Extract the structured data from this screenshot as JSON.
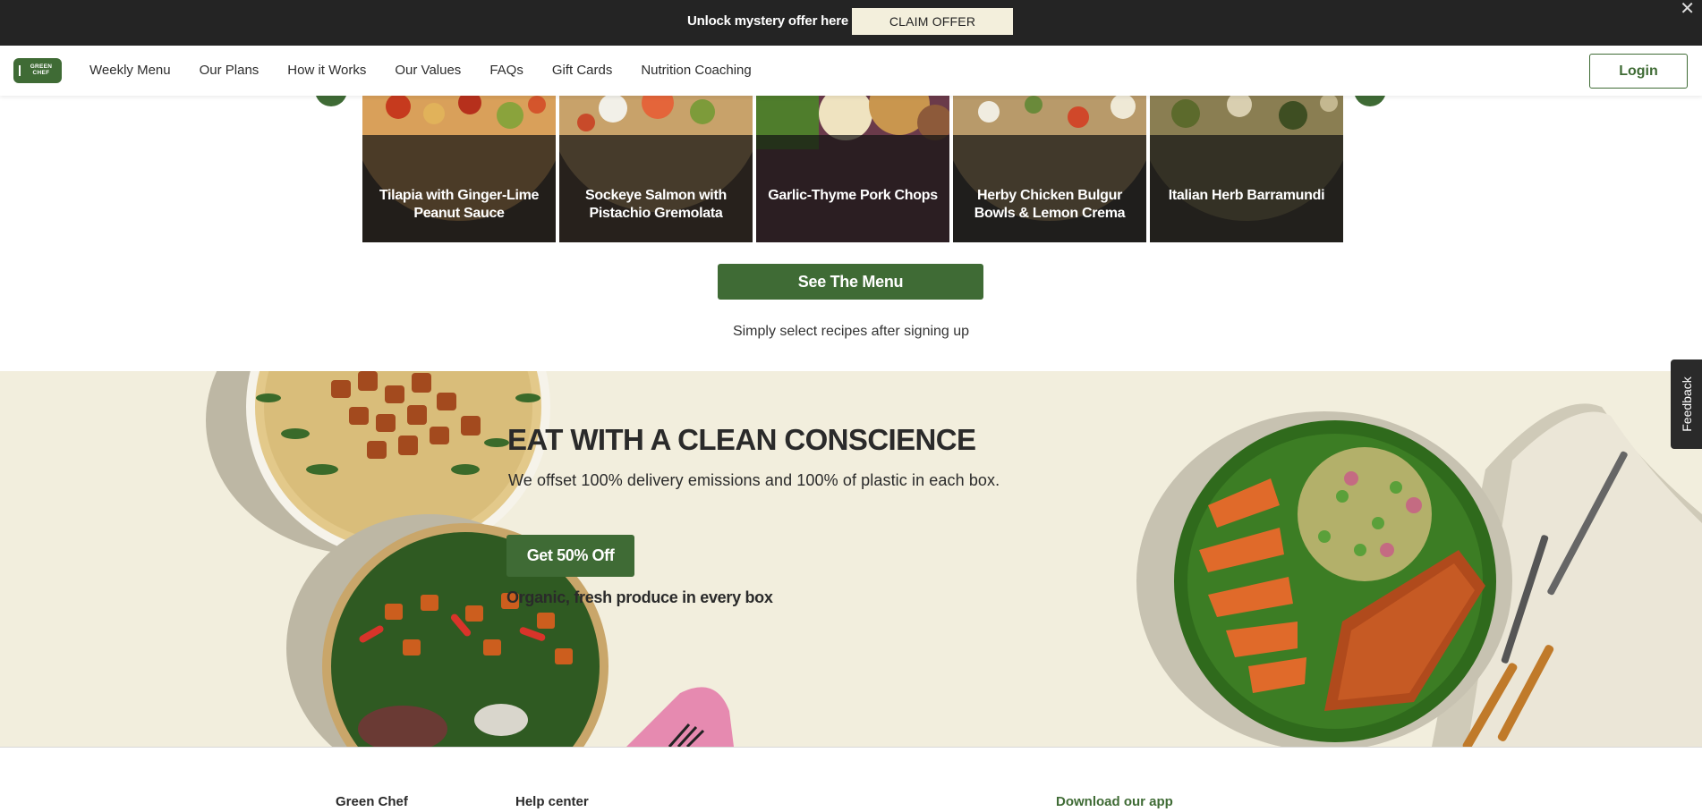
{
  "promo": {
    "text": "Unlock mystery offer here",
    "button_label": "CLAIM OFFER",
    "close_icon": "close-icon"
  },
  "header": {
    "logo_text": "GREEN CHEF",
    "nav": [
      "Weekly Menu",
      "Our Plans",
      "How it Works",
      "Our Values",
      "FAQs",
      "Gift Cards",
      "Nutrition Coaching"
    ],
    "login_label": "Login"
  },
  "carousel": {
    "recipes": [
      {
        "title": "Tilapia with Ginger-Lime Peanut Sauce"
      },
      {
        "title": "Sockeye Salmon with Pistachio Gremolata"
      },
      {
        "title": "Garlic-Thyme Pork Chops"
      },
      {
        "title": "Herby Chicken Bulgur Bowls & Lemon Crema"
      },
      {
        "title": "Italian Herb Barramundi"
      }
    ],
    "prev_icon": "chevron-left-icon",
    "next_icon": "chevron-right-icon"
  },
  "menu_cta": {
    "button_label": "See The Menu",
    "subtext": "Simply select recipes after signing up"
  },
  "conscience": {
    "heading": "EAT WITH A CLEAN CONSCIENCE",
    "subheading": "We offset 100% delivery emissions and 100% of plastic in each box.",
    "button_label": "Get 50% Off",
    "note": "Organic, fresh produce in every box"
  },
  "footer": {
    "columns": [
      "Green Chef",
      "Help center",
      "Download our app"
    ]
  },
  "feedback": {
    "label": "Feedback"
  },
  "colors": {
    "brand_green": "#3f6b35",
    "promo_bg": "#242424",
    "section_bg": "#f2eedd"
  }
}
